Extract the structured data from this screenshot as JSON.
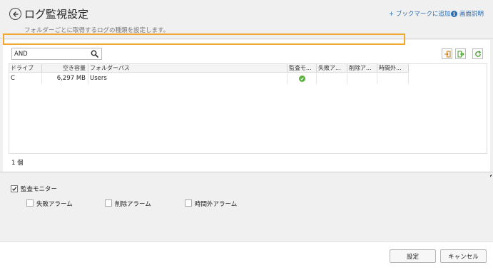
{
  "header": {
    "title": "ログ監視設定",
    "subtitle": "フォルダーごとに取得するログの種類を設定します。",
    "bookmark_link": "+ ブックマークに追加",
    "help_link": "画面説明"
  },
  "search": {
    "value": "AND",
    "icon": "search-icon"
  },
  "toolbar": {
    "buttons": [
      "import-icon",
      "export-icon",
      "refresh-icon"
    ]
  },
  "table": {
    "columns": [
      "ドライブ",
      "空き容量",
      "フォルダーパス",
      "監査モ...",
      "失敗ア...",
      "削除ア...",
      "時間外..."
    ],
    "rows": [
      {
        "drive": "C",
        "free_space": "6,297 MB",
        "folder_path": "Users",
        "audit_monitor": "check-circle-icon",
        "fail_alarm": "",
        "delete_alarm": "",
        "after_hours": ""
      }
    ],
    "count_label": "1 個"
  },
  "settings": {
    "audit_monitor": {
      "label": "監査モニター",
      "checked": true
    },
    "fail_alarm": {
      "label": "失敗アラーム",
      "checked": false
    },
    "delete_alarm": {
      "label": "削除アラーム",
      "checked": false
    },
    "after_hours_alarm": {
      "label": "時間外アラーム",
      "checked": false
    }
  },
  "footer": {
    "ok_label": "設定",
    "cancel_label": "キャンセル"
  },
  "colors": {
    "link": "#2b6cb0",
    "highlight": "#f0a830",
    "ok_check": "#5ab03c"
  }
}
